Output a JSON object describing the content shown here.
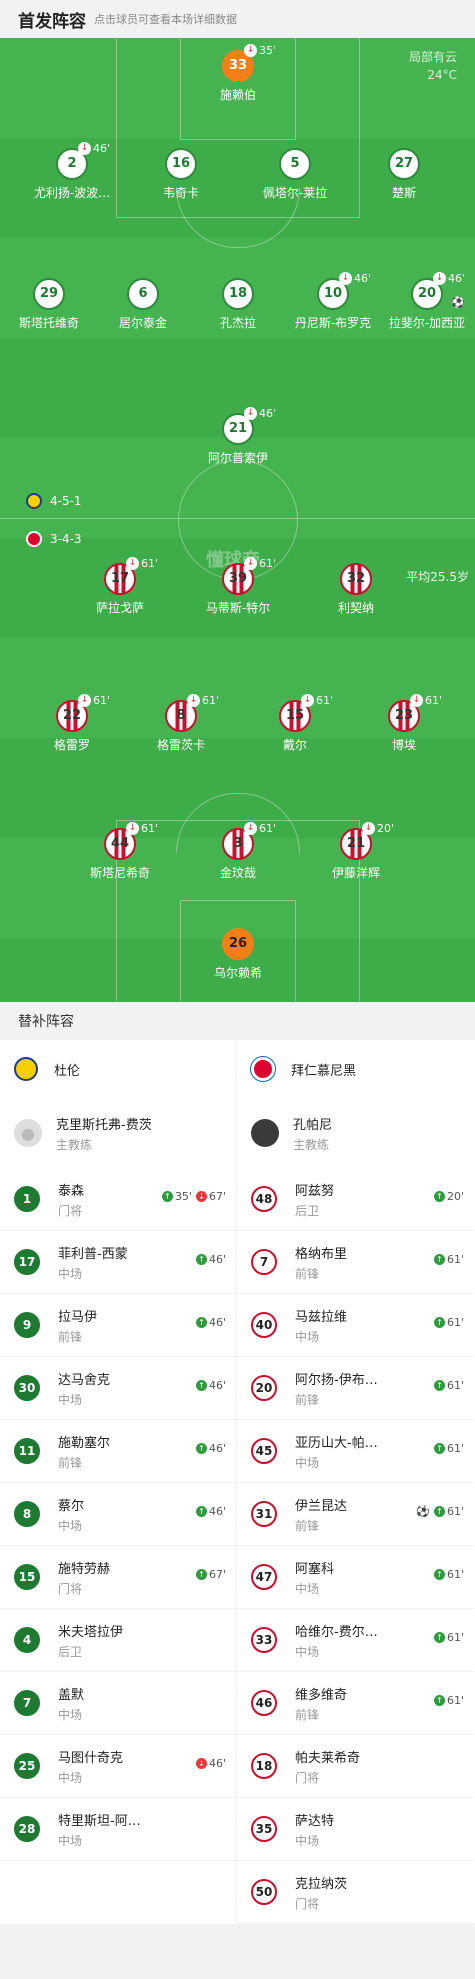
{
  "header": {
    "title": "首发阵容",
    "hint": "点击球员可查看本场详细数据"
  },
  "weather": {
    "line1": "局部有云",
    "line2": "24°C"
  },
  "watermark": "懂球帝",
  "formation": {
    "home": "4-5-1",
    "away": "3-4-3"
  },
  "avg_age": "平均25.5岁",
  "colors": {
    "pitch": "#3fac4a",
    "home": "#1e7a30",
    "away": "#c8102e",
    "gk": "#f57f17"
  },
  "home_players": [
    {
      "num": "33",
      "name": "施赖伯",
      "gk": true,
      "event": "35'"
    },
    {
      "num": "2",
      "name": "尤利扬-波波…",
      "event": "46'"
    },
    {
      "num": "16",
      "name": "韦奇卡",
      "event": ""
    },
    {
      "num": "5",
      "name": "佩塔尔-莱拉",
      "event": ""
    },
    {
      "num": "27",
      "name": "楚斯",
      "event": ""
    },
    {
      "num": "29",
      "name": "斯塔托维奇",
      "event": ""
    },
    {
      "num": "6",
      "name": "居尔泰金",
      "event": ""
    },
    {
      "num": "18",
      "name": "孔杰拉",
      "event": ""
    },
    {
      "num": "10",
      "name": "丹尼斯-布罗克",
      "event": "46'"
    },
    {
      "num": "20",
      "name": "拉斐尔-加西亚",
      "event": "46'",
      "goal": true
    },
    {
      "num": "21",
      "name": "阿尔普索伊",
      "event": "46'"
    }
  ],
  "away_players": [
    {
      "num": "17",
      "name": "萨拉戈萨",
      "event": "61'"
    },
    {
      "num": "39",
      "name": "马蒂斯-特尔",
      "event": "61'"
    },
    {
      "num": "32",
      "name": "利契纳",
      "event": ""
    },
    {
      "num": "22",
      "name": "格雷罗",
      "event": "61'"
    },
    {
      "num": "8",
      "name": "格雷茨卡",
      "event": "61'"
    },
    {
      "num": "15",
      "name": "戴尔",
      "event": "61'"
    },
    {
      "num": "23",
      "name": "博埃",
      "event": "61'"
    },
    {
      "num": "44",
      "name": "斯塔尼希奇",
      "event": "61'"
    },
    {
      "num": "3",
      "name": "金玟哉",
      "event": "61'"
    },
    {
      "num": "21",
      "name": "伊藤洋辉",
      "event": "20'"
    },
    {
      "num": "26",
      "name": "乌尔赖希",
      "gk": true,
      "event": ""
    }
  ],
  "subs_title": "替补阵容",
  "home_team": {
    "name": "杜伦",
    "coach_name": "克里斯托弗-费茨",
    "coach_role": "主教练"
  },
  "away_team": {
    "name": "拜仁慕尼黑",
    "coach_name": "孔帕尼",
    "coach_role": "主教练"
  },
  "home_subs": [
    {
      "num": "1",
      "name": "泰森",
      "pos": "门将",
      "in": "35'",
      "out": "67'"
    },
    {
      "num": "17",
      "name": "菲利普-西蒙",
      "pos": "中场",
      "in": "46'"
    },
    {
      "num": "9",
      "name": "拉马伊",
      "pos": "前锋",
      "in": "46'"
    },
    {
      "num": "30",
      "name": "达马舍克",
      "pos": "中场",
      "in": "46'"
    },
    {
      "num": "11",
      "name": "施勒塞尔",
      "pos": "前锋",
      "in": "46'"
    },
    {
      "num": "8",
      "name": "蔡尔",
      "pos": "中场",
      "in": "46'"
    },
    {
      "num": "15",
      "name": "施特劳赫",
      "pos": "门将",
      "in": "67'"
    },
    {
      "num": "4",
      "name": "米夫塔拉伊",
      "pos": "后卫"
    },
    {
      "num": "7",
      "name": "盖默",
      "pos": "中场"
    },
    {
      "num": "25",
      "name": "马图什奇克",
      "pos": "中场",
      "out": "46'"
    },
    {
      "num": "28",
      "name": "特里斯坦-阿…",
      "pos": "中场"
    }
  ],
  "away_subs": [
    {
      "num": "48",
      "name": "阿兹努",
      "pos": "后卫",
      "in": "20'"
    },
    {
      "num": "7",
      "name": "格纳布里",
      "pos": "前锋",
      "in": "61'"
    },
    {
      "num": "40",
      "name": "马兹拉维",
      "pos": "中场",
      "in": "61'"
    },
    {
      "num": "20",
      "name": "阿尔扬-伊布…",
      "pos": "前锋",
      "in": "61'"
    },
    {
      "num": "45",
      "name": "亚历山大-帕…",
      "pos": "中场",
      "in": "61'"
    },
    {
      "num": "31",
      "name": "伊兰昆达",
      "pos": "前锋",
      "in": "61'",
      "goal": true
    },
    {
      "num": "47",
      "name": "阿塞科",
      "pos": "中场",
      "in": "61'"
    },
    {
      "num": "33",
      "name": "哈维尔-费尔…",
      "pos": "中场",
      "in": "61'"
    },
    {
      "num": "46",
      "name": "维多维奇",
      "pos": "前锋",
      "in": "61'"
    },
    {
      "num": "18",
      "name": "帕夫莱希奇",
      "pos": "门将"
    },
    {
      "num": "35",
      "name": "萨达特",
      "pos": "中场"
    },
    {
      "num": "50",
      "name": "克拉纳茨",
      "pos": "门将"
    }
  ]
}
